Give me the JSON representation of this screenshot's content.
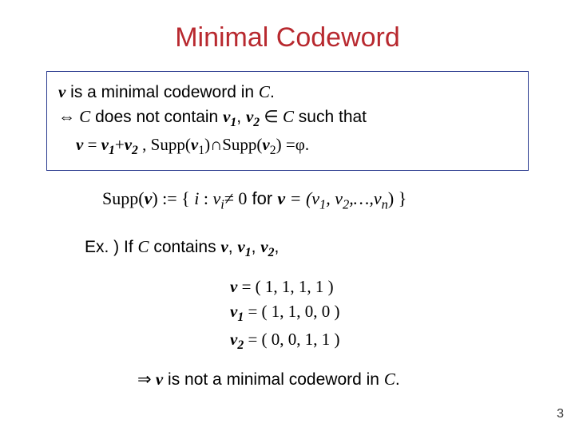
{
  "title": "Minimal Codeword",
  "def": {
    "v": "v",
    "line1a": " is a minimal codeword in ",
    "C": "C",
    "period": ".",
    "iff": "⇔ ",
    "line2a": " does not contain ",
    "v1": "v",
    "sub1": "1",
    "comma": ", ",
    "v2": "v",
    "sub2": "2",
    "in": " ∈ ",
    "line2b": "  such that",
    "eq_lhs": "v",
    "eq_eq": " = ",
    "eq_v1": "v",
    "eq_s1": "1",
    "eq_plus": "+",
    "eq_v2": "v",
    "eq_s2": "2",
    "eq_sep": " , ",
    "supp1_pre": "Supp(",
    "supp1_v": "v",
    "supp1_s": "1",
    "supp1_close": ")",
    "cap": "∩",
    "supp2_pre": "Supp(",
    "supp2_v": "v",
    "supp2_s": "2",
    "supp2_close": ")",
    "eqphi": " =φ."
  },
  "supp": {
    "pre": "Supp(",
    "v": "v",
    "mid1": ") := { ",
    "i": "i",
    "mid2": " : ",
    "vi": "v",
    "isub": "i",
    "neq": "≠ 0",
    "for": "  for  ",
    "vdef_v": "v",
    "vdef_eq": " = (",
    "c1": "v",
    "c1s": "1",
    "sep": ", ",
    "c2": "v",
    "c2s": "2",
    "dots": ",…,",
    "cn": "v",
    "cns": "n",
    "end": ") }"
  },
  "ex": {
    "label": "Ex. )   If ",
    "C": "C",
    "contains": " contains ",
    "v": "v",
    "sep1": ", ",
    "v1": "v",
    "s1": "1",
    "sep2": ", ",
    "v2": "v",
    "s2": "2",
    "comma": ","
  },
  "vec": {
    "v": "v",
    "vsp": "   = ( 1, 1, 1, 1 )",
    "v1": "v",
    "s1": "1",
    "v1v": " = ( 1, 1, 0, 0 )",
    "v2": "v",
    "s2": "2",
    "v2v": " = ( 0, 0, 1, 1 )"
  },
  "concl": {
    "arrow": "⇒ ",
    "v": "v",
    "text": " is not a minimal codeword in  ",
    "C": "C",
    "period": "."
  },
  "pagenum": "3"
}
